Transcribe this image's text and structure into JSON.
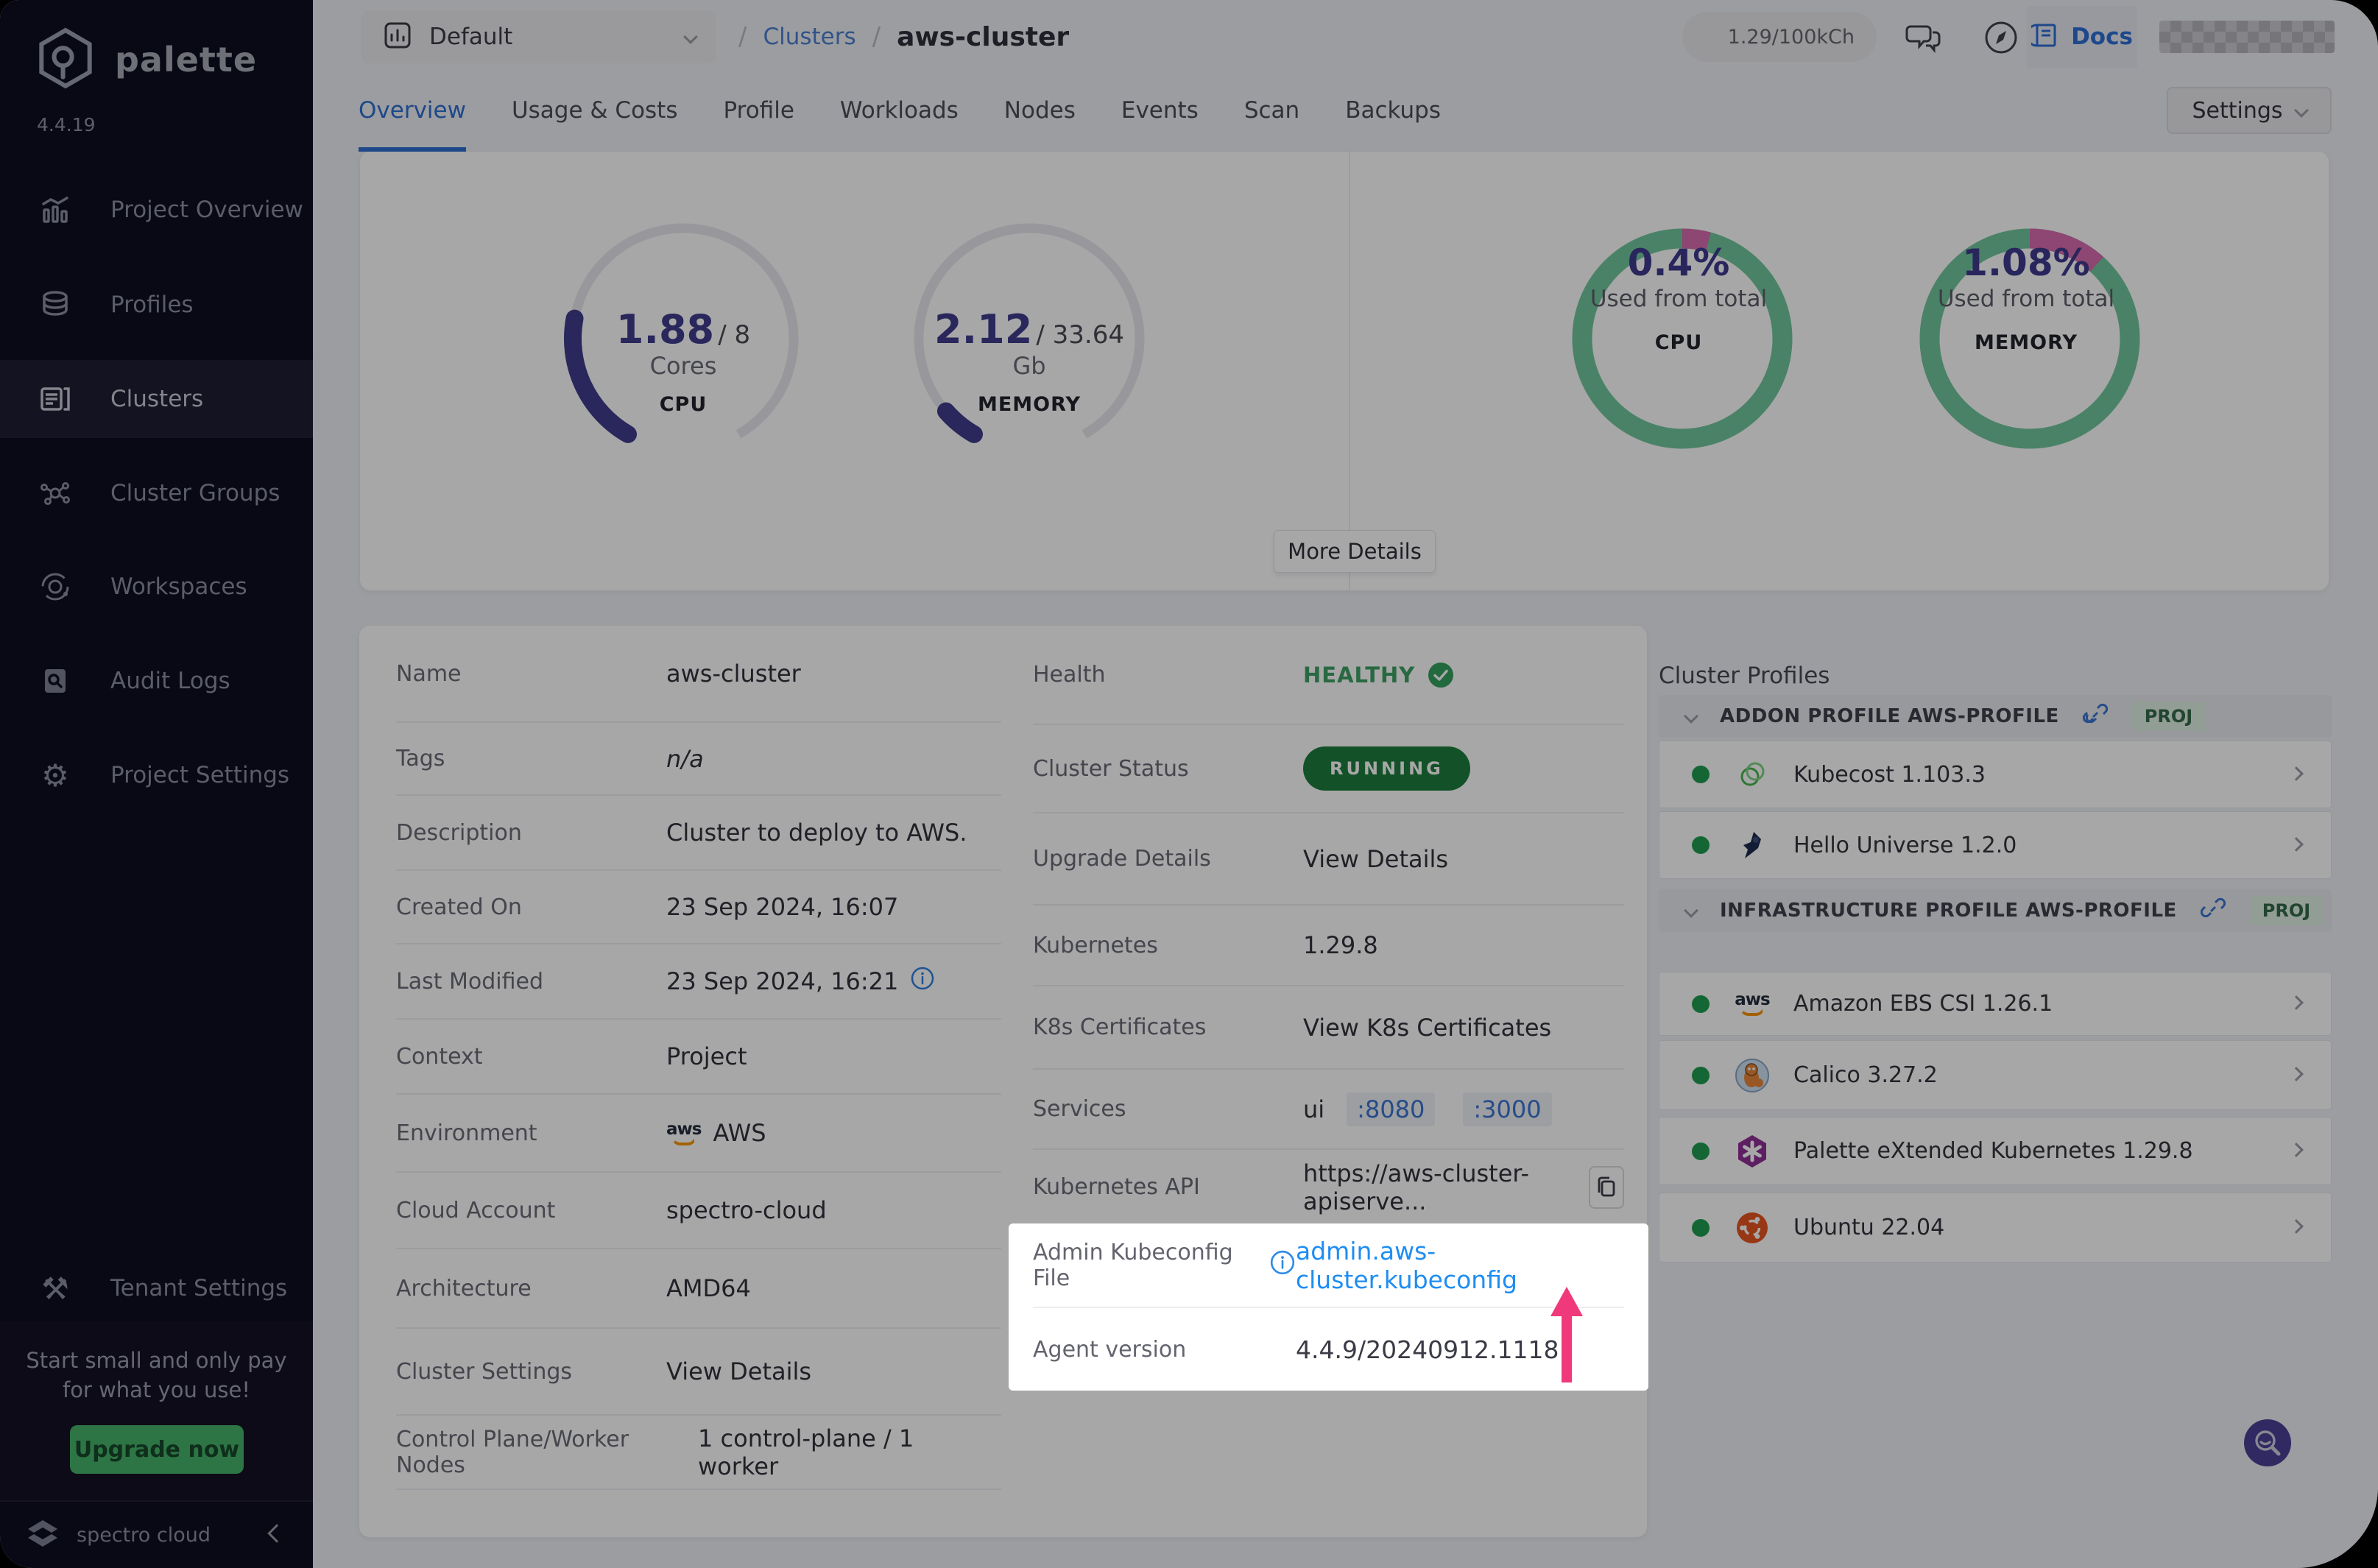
{
  "sidebar": {
    "brand": "palette",
    "version": "4.4.19",
    "items": [
      {
        "label": "Project Overview"
      },
      {
        "label": "Profiles"
      },
      {
        "label": "Clusters",
        "active": true
      },
      {
        "label": "Cluster Groups"
      },
      {
        "label": "Workspaces"
      },
      {
        "label": "Audit Logs"
      },
      {
        "label": "Project Settings"
      }
    ],
    "tenant_label": "Tenant Settings",
    "promo_line1": "Start small and only pay",
    "promo_line2": "for what you use!",
    "upgrade_label": "Upgrade now",
    "footer_brand": "spectro cloud"
  },
  "topbar": {
    "project": "Default",
    "breadcrumb_sep": "/",
    "breadcrumb_section": "Clusters",
    "breadcrumb_current": "aws-cluster",
    "usage": "1.29/100kCh",
    "docs_label": "Docs",
    "settings_label": "Settings"
  },
  "tabs": [
    "Overview",
    "Usage & Costs",
    "Profile",
    "Workloads",
    "Nodes",
    "Events",
    "Scan",
    "Backups"
  ],
  "overview": {
    "cpu_gauge": {
      "value": "1.88",
      "total": "/ 8",
      "unit": "Cores",
      "label": "CPU",
      "used": 1.88,
      "max": 8
    },
    "mem_gauge": {
      "value": "2.12",
      "total": "/ 33.64",
      "unit": "Gb",
      "label": "MEMORY",
      "used": 2.12,
      "max": 33.64
    },
    "cpu_donut": {
      "pct": "0.4%",
      "caption": "Used from total",
      "label": "CPU",
      "pink_deg": 15
    },
    "mem_donut": {
      "pct": "1.08%",
      "caption": "Used from total",
      "label": "MEMORY",
      "pink_deg": 42
    },
    "more_details": "More Details",
    "gauge_color": "#413c8d",
    "ring_green": "#71c79e",
    "ring_pink": "#d96bae"
  },
  "details": {
    "left": [
      {
        "label": "Name",
        "value": "aws-cluster"
      },
      {
        "label": "Tags",
        "value": "n/a"
      },
      {
        "label": "Description",
        "value": "Cluster to deploy to AWS."
      },
      {
        "label": "Created On",
        "value": "23 Sep 2024, 16:07"
      },
      {
        "label": "Last Modified",
        "value": "23 Sep 2024, 16:21"
      },
      {
        "label": "Context",
        "value": "Project"
      },
      {
        "label": "Environment",
        "value": "AWS"
      },
      {
        "label": "Cloud Account",
        "value": "spectro-cloud"
      },
      {
        "label": "Architecture",
        "value": "AMD64"
      },
      {
        "label": "Cluster Settings",
        "value": "View Details"
      },
      {
        "label": "Control Plane/Worker Nodes",
        "value": "1 control-plane / 1 worker"
      }
    ],
    "right": [
      {
        "label": "Health",
        "value": "HEALTHY"
      },
      {
        "label": "Cluster Status",
        "value": "RUNNING"
      },
      {
        "label": "Upgrade Details",
        "value": "View Details"
      },
      {
        "label": "Kubernetes",
        "value": "1.29.8"
      },
      {
        "label": "K8s Certificates",
        "value": "View K8s Certificates"
      },
      {
        "label": "Services",
        "prefix": "ui",
        "ports": [
          ":8080",
          ":3000"
        ]
      },
      {
        "label": "Kubernetes API",
        "value": "https://aws-cluster-apiserve..."
      }
    ]
  },
  "spotlight": {
    "label": "Admin Kubeconfig File",
    "link": "admin.aws-cluster.kubeconfig",
    "agent_label": "Agent version",
    "agent_value": "4.4.9/20240912.1118",
    "arrow_color": "#f0397a"
  },
  "profiles": {
    "title": "Cluster Profiles",
    "addon": {
      "header": "ADDON PROFILE AWS-PROFILE",
      "badge": "PROJ",
      "items": [
        {
          "name": "Kubecost 1.103.3"
        },
        {
          "name": "Hello Universe 1.2.0"
        }
      ]
    },
    "infra": {
      "header": "INFRASTRUCTURE PROFILE AWS-PROFILE",
      "badge": "PROJ",
      "items": [
        {
          "name": "Amazon EBS CSI 1.26.1"
        },
        {
          "name": "Calico 3.27.2"
        },
        {
          "name": "Palette eXtended Kubernetes 1.29.8"
        },
        {
          "name": "Ubuntu 22.04"
        }
      ]
    }
  },
  "colors": {
    "accent_blue": "#2e6fd2",
    "link_blue": "#3b74d1",
    "bright_link_blue": "#1e8df2",
    "green": "#1e7e3e",
    "healthy_green": "#3da066",
    "upgrade_green": "#46b368",
    "gauge_indigo": "#413c8d",
    "ring_green": "#71c79e",
    "ring_pink": "#d96bae",
    "arrow_pink": "#f0397a",
    "sidebar_bg": "#0e0d20"
  }
}
